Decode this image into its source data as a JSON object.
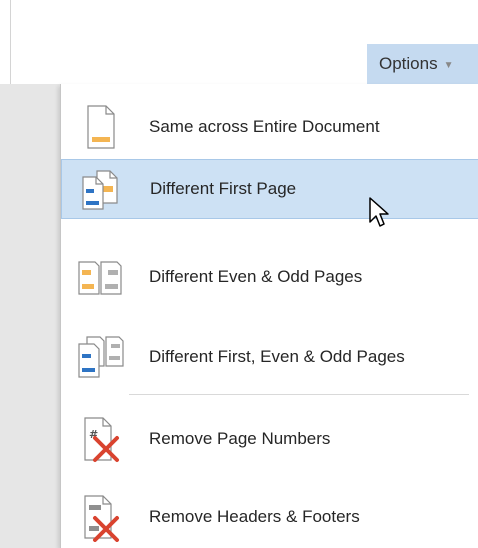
{
  "toolbar": {
    "options_label": "Options"
  },
  "menu": {
    "items": [
      {
        "label": "Same across Entire Document",
        "icon": "page-same-icon"
      },
      {
        "label": "Different First Page",
        "icon": "page-different-first-icon",
        "highlighted": true
      },
      {
        "label": "Different Even & Odd Pages",
        "icon": "page-even-odd-icon"
      },
      {
        "label": "Different First, Even & Odd Pages",
        "icon": "page-first-even-odd-icon"
      },
      {
        "label": "Remove Page Numbers",
        "icon": "remove-page-numbers-icon"
      },
      {
        "label": "Remove Headers & Footers",
        "icon": "remove-headers-footers-icon"
      }
    ]
  },
  "colors": {
    "accent_orange": "#f4b552",
    "accent_blue": "#2e74c4",
    "remove_red": "#d9432f",
    "highlight": "#cde1f4"
  }
}
